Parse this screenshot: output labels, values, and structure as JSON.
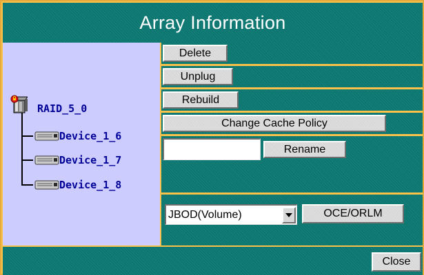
{
  "window": {
    "title": "Array Information"
  },
  "tree": {
    "array": {
      "name": "RAID_5_0",
      "icon": "locked-array-icon"
    },
    "devices": [
      {
        "name": "Device_1_6",
        "icon": "disk-drive-icon"
      },
      {
        "name": "Device_1_7",
        "icon": "disk-drive-icon"
      },
      {
        "name": "Device_1_8",
        "icon": "disk-drive-icon"
      }
    ]
  },
  "actions": {
    "delete_label": "Delete",
    "unplug_label": "Unplug",
    "rebuild_label": "Rebuild",
    "cache_policy_label": "Change Cache Policy",
    "rename_label": "Rename",
    "rename_input": {
      "value": "",
      "placeholder": ""
    },
    "array_type_select": {
      "selected": "JBOD(Volume)"
    },
    "oce_label": "OCE/ORLM"
  },
  "footer": {
    "close_label": "Close"
  },
  "colors": {
    "panel_teal": "#0c7670",
    "border_gold": "#fbc24a",
    "tree_bg": "#ccccff",
    "tree_text": "#000099",
    "button_face": "#d8d8d8"
  }
}
